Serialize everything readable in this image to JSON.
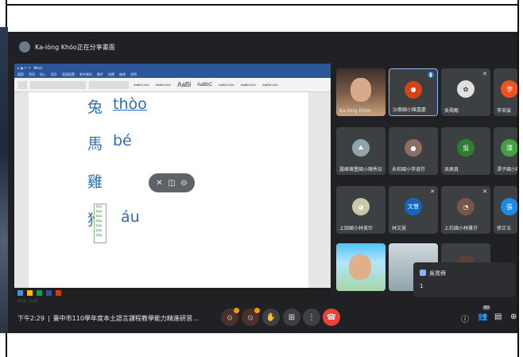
{
  "share": {
    "title": "Ka-lòng Khóo正在分享畫面"
  },
  "word": {
    "title": "Word",
    "tabs": [
      "檔案",
      "常用",
      "插入",
      "設計",
      "版面配置",
      "參考資料",
      "郵件",
      "校閱",
      "檢視",
      "說明"
    ],
    "styles": [
      "AaBbCcDc",
      "AaBbCcDc",
      "AaBl",
      "AaBbC",
      "AaBbCcDc",
      "AaBbCcDc",
      "AaBbCcDc"
    ],
    "vocab": [
      {
        "han": "兔",
        "roman": "thòo"
      },
      {
        "han": "馬",
        "roman": "bé"
      },
      {
        "han": "雞",
        "roman": ""
      },
      {
        "han": "狗",
        "roman": "áu"
      }
    ],
    "autocomplete": [
      "káu",
      "kau",
      "káu",
      "kàu",
      "kāu",
      "kâu",
      "kǎu"
    ],
    "status": "第1頁，共1頁"
  },
  "participants": [
    {
      "name": "Ka-lòng Khóo",
      "avatar_color": "#6d4c41",
      "has_video": true
    },
    {
      "name": "沙鹿國小陳嘉慶",
      "avatar_color": "#d84315",
      "letter": "",
      "speaking": true
    },
    {
      "name": "吳珮甄",
      "avatar_color": "#8d8d8d",
      "letter": ""
    },
    {
      "name": "李采宸",
      "avatar_color": "#f4511e",
      "letter": "李"
    },
    {
      "name": "霧峰萬豐國小陳秀珍",
      "avatar_color": "#5c6bc0",
      "letter": ""
    },
    {
      "name": "永和國小李淑芬",
      "avatar_color": "#8d6e63",
      "letter": ""
    },
    {
      "name": "吳佩真",
      "avatar_color": "#2e7d32",
      "letter": "吳"
    },
    {
      "name": "潭子國小陳",
      "avatar_color": "#43a047",
      "letter": "潭"
    },
    {
      "name": "上田國小林美玲",
      "avatar_color": "#9e9d24",
      "letter": ""
    },
    {
      "name": "林文慧",
      "avatar_color": "#1565c0",
      "letter": "文慧"
    },
    {
      "name": "上石國小林雅芬",
      "avatar_color": "#795548",
      "letter": ""
    },
    {
      "name": "張正玉",
      "avatar_color": "#1e88e5",
      "letter": "張"
    },
    {
      "name": "",
      "avatar_color": "#4fc3f7",
      "has_video": true
    },
    {
      "name": "",
      "avatar_color": "#90a4ae",
      "has_video": true
    },
    {
      "name": "",
      "avatar_color": "#5d4037",
      "letter": ""
    },
    {
      "name": "",
      "avatar_color": "#3c4043",
      "letter": ""
    }
  ],
  "chat": {
    "name": "吳胃舜",
    "message": "1"
  },
  "meeting": {
    "time": "下午2:29",
    "title": "臺中市110學年度本土語言課程教學能力精進研習..."
  },
  "controls": {
    "people_count": "60"
  }
}
